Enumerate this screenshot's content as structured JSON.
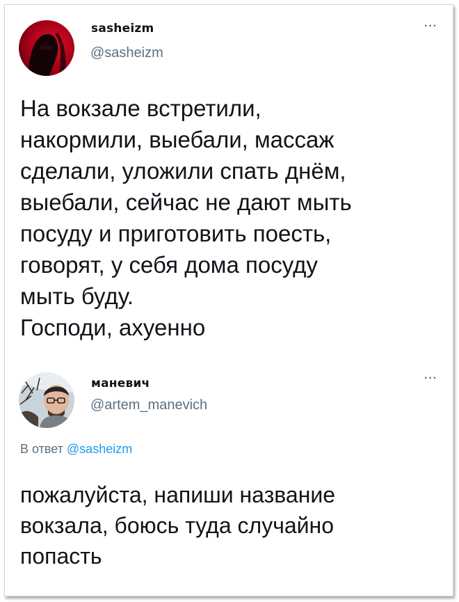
{
  "tweets": [
    {
      "name": "sasheizm",
      "handle": "@sasheizm",
      "more_label": "···",
      "text": "На вокзале встретили,\nнакормили, выебали, массаж\nсделали, уложили спать днём,\nвыебали, сейчас не дают мыть\nпосуду и приготовить поесть,\nговорят, у себя дома посуду\nмыть буду.\nГосподи, ахуенно"
    },
    {
      "name": "маневич",
      "handle": "@artem_manevich",
      "more_label": "···",
      "reply_prefix": "В ответ",
      "reply_handle": "@sasheizm",
      "text": "пожалуйста, напиши название\nвокзала, боюсь туда случайно\nпопасть"
    }
  ],
  "colors": {
    "text": "#0f1419",
    "secondary": "#5b7083",
    "link": "#1d9bf0",
    "avatar1_bg": "#b3001b"
  }
}
